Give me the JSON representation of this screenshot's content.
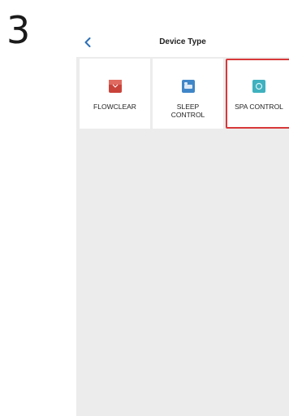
{
  "step": "3",
  "header": {
    "back_icon": "chevron-left-icon",
    "title": "Device Type"
  },
  "devices": [
    {
      "label": "FLOWCLEAR",
      "icon": "flowclear-icon",
      "color": "#c9433b"
    },
    {
      "label": "SLEEP\nCONTROL",
      "icon": "sleep-control-icon",
      "color": "#3f86c8"
    },
    {
      "label": "SPA CONTROL",
      "icon": "spa-control-icon",
      "color": "#3fb1bf",
      "selected": true
    }
  ],
  "colors": {
    "accent": "#2c6fb7",
    "selected_border": "#d8383a",
    "background": "#ececec"
  }
}
